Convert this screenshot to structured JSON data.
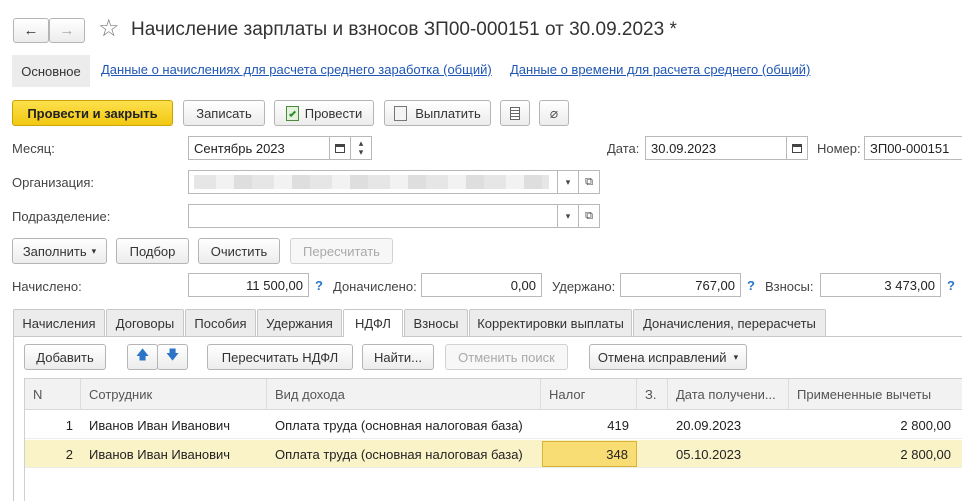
{
  "window": {
    "title": "Начисление зарплаты и взносов ЗП00-000151 от 30.09.2023 *"
  },
  "nav": {
    "back": "←",
    "forward": "→",
    "star": "☆"
  },
  "sections": {
    "main": "Основное",
    "link1": "Данные о начислениях для расчета среднего заработка (общий)",
    "link2": "Данные о времени для расчета среднего (общий)"
  },
  "toolbar": {
    "post_close": "Провести и закрыть",
    "save": "Записать",
    "post": "Провести",
    "pay": "Выплатить"
  },
  "form": {
    "month_label": "Месяц:",
    "month_value": "Сентябрь 2023",
    "date_label": "Дата:",
    "date_value": "30.09.2023",
    "number_label": "Номер:",
    "number_value": "ЗП00-000151",
    "org_label": "Организация:",
    "dept_label": "Подразделение:"
  },
  "actions": {
    "fill": "Заполнить",
    "select": "Подбор",
    "clear": "Очистить",
    "recalc": "Пересчитать"
  },
  "totals": {
    "accrued_label": "Начислено:",
    "accrued": "11 500,00",
    "extra_label": "Доначислено:",
    "extra": "0,00",
    "withheld_label": "Удержано:",
    "withheld": "767,00",
    "contrib_label": "Взносы:",
    "contrib": "3 473,00",
    "help": "?"
  },
  "tabs": [
    "Начисления",
    "Договоры",
    "Пособия",
    "Удержания",
    "НДФЛ",
    "Взносы",
    "Корректировки выплаты",
    "Доначисления, перерасчеты"
  ],
  "ndfl_toolbar": {
    "add": "Добавить",
    "recalc_ndfl": "Пересчитать НДФЛ",
    "find": "Найти...",
    "cancel_search": "Отменить поиск",
    "cancel_fix": "Отмена исправлений"
  },
  "table": {
    "columns": [
      "N",
      "Сотрудник",
      "Вид дохода",
      "Налог",
      "З.",
      "Дата получени...",
      "Примененные вычеты"
    ],
    "rows": [
      {
        "n": "1",
        "employee": "Иванов Иван Иванович",
        "income": "Оплата труда (основная налоговая база)",
        "tax": "419",
        "z": "",
        "date": "20.09.2023",
        "deductions": "2 800,00"
      },
      {
        "n": "2",
        "employee": "Иванов Иван Иванович",
        "income": "Оплата труда (основная налоговая база)",
        "tax": "348",
        "z": "",
        "date": "05.10.2023",
        "deductions": "2 800,00"
      }
    ]
  },
  "colors": {
    "primary": "#f5cf1f",
    "selected_row": "#fbf3c8",
    "selected_cell": "#f8dc74",
    "link": "#1f56b5"
  }
}
